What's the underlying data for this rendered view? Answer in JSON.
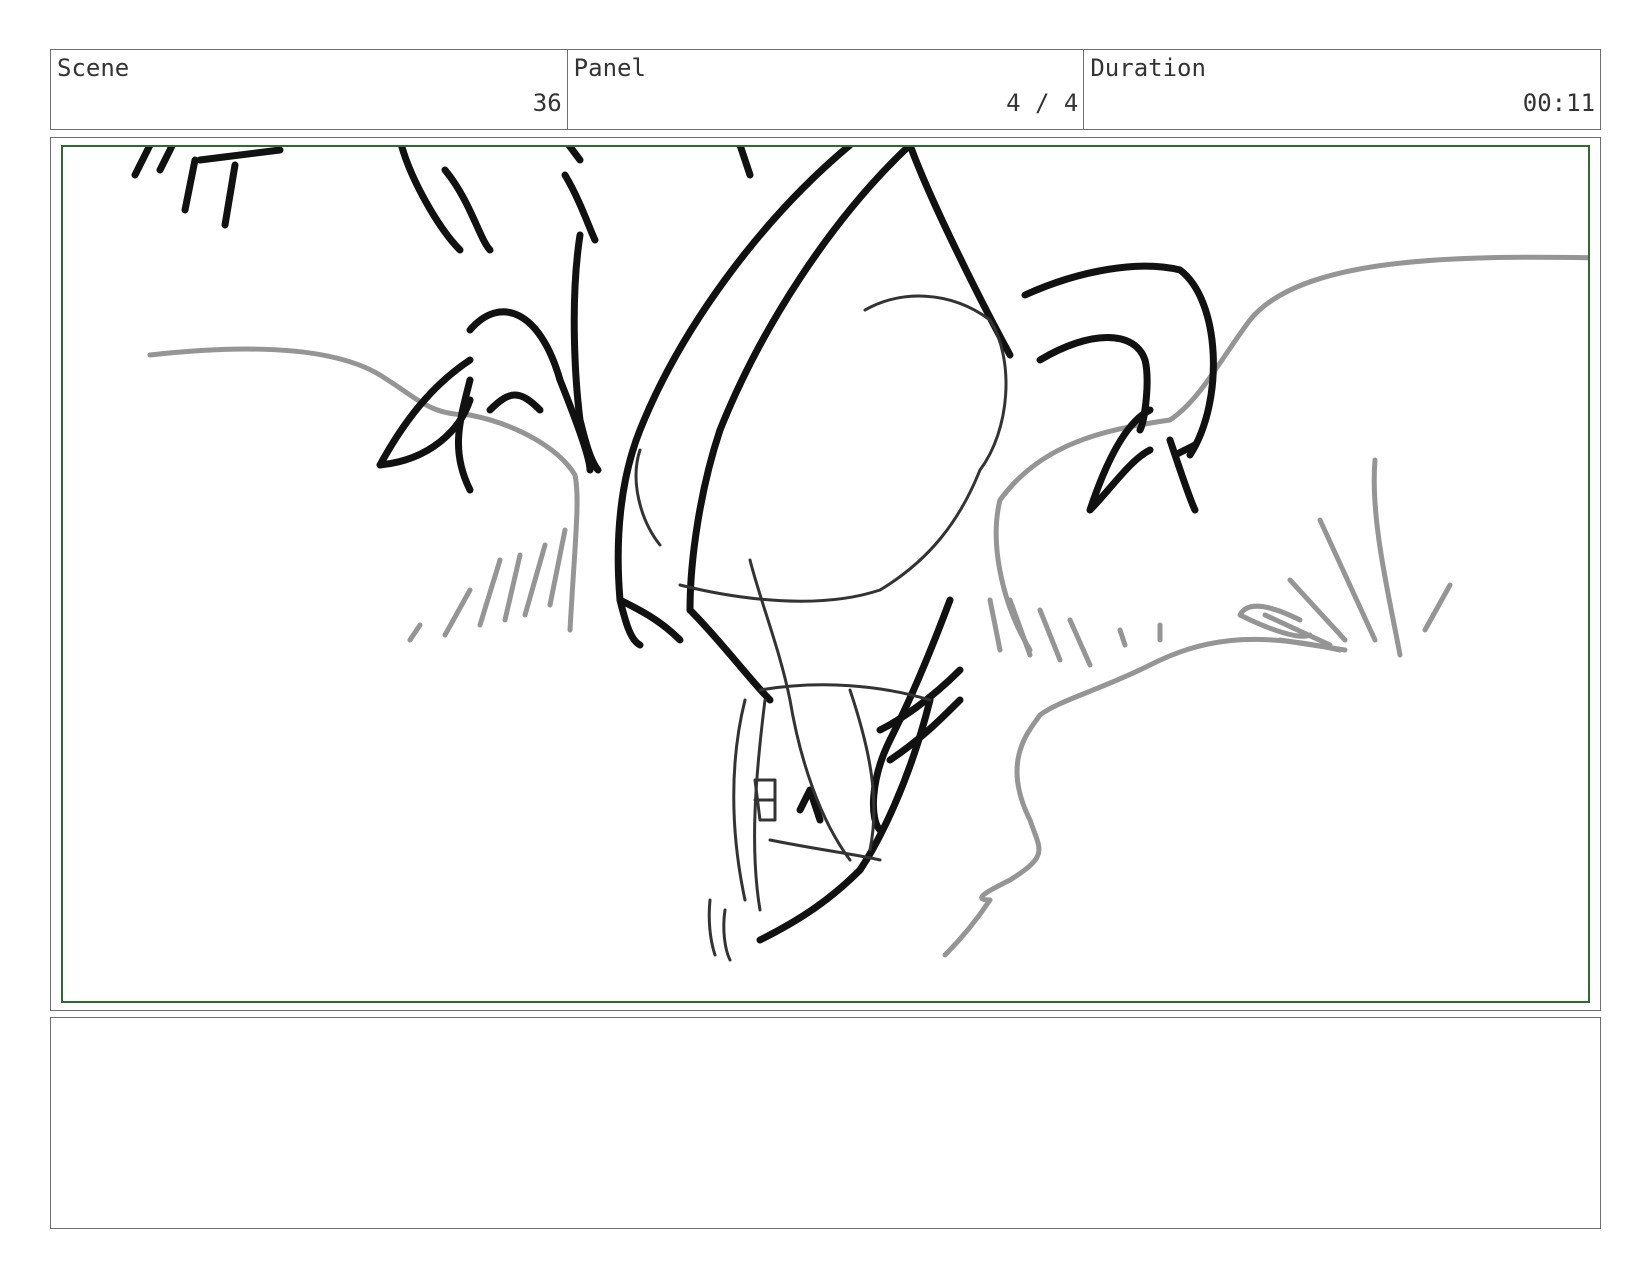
{
  "header": {
    "scene_label": "Scene",
    "scene_value": "36",
    "panel_label": "Panel",
    "panel_value": "4 / 4",
    "duration_label": "Duration",
    "duration_value": "00:11"
  },
  "notes": {
    "text": ""
  },
  "colors": {
    "border": "#6e6e6e",
    "safe_frame": "#2e6b2e",
    "ink_dark": "#111111",
    "ink_light": "#8a8a8a"
  }
}
